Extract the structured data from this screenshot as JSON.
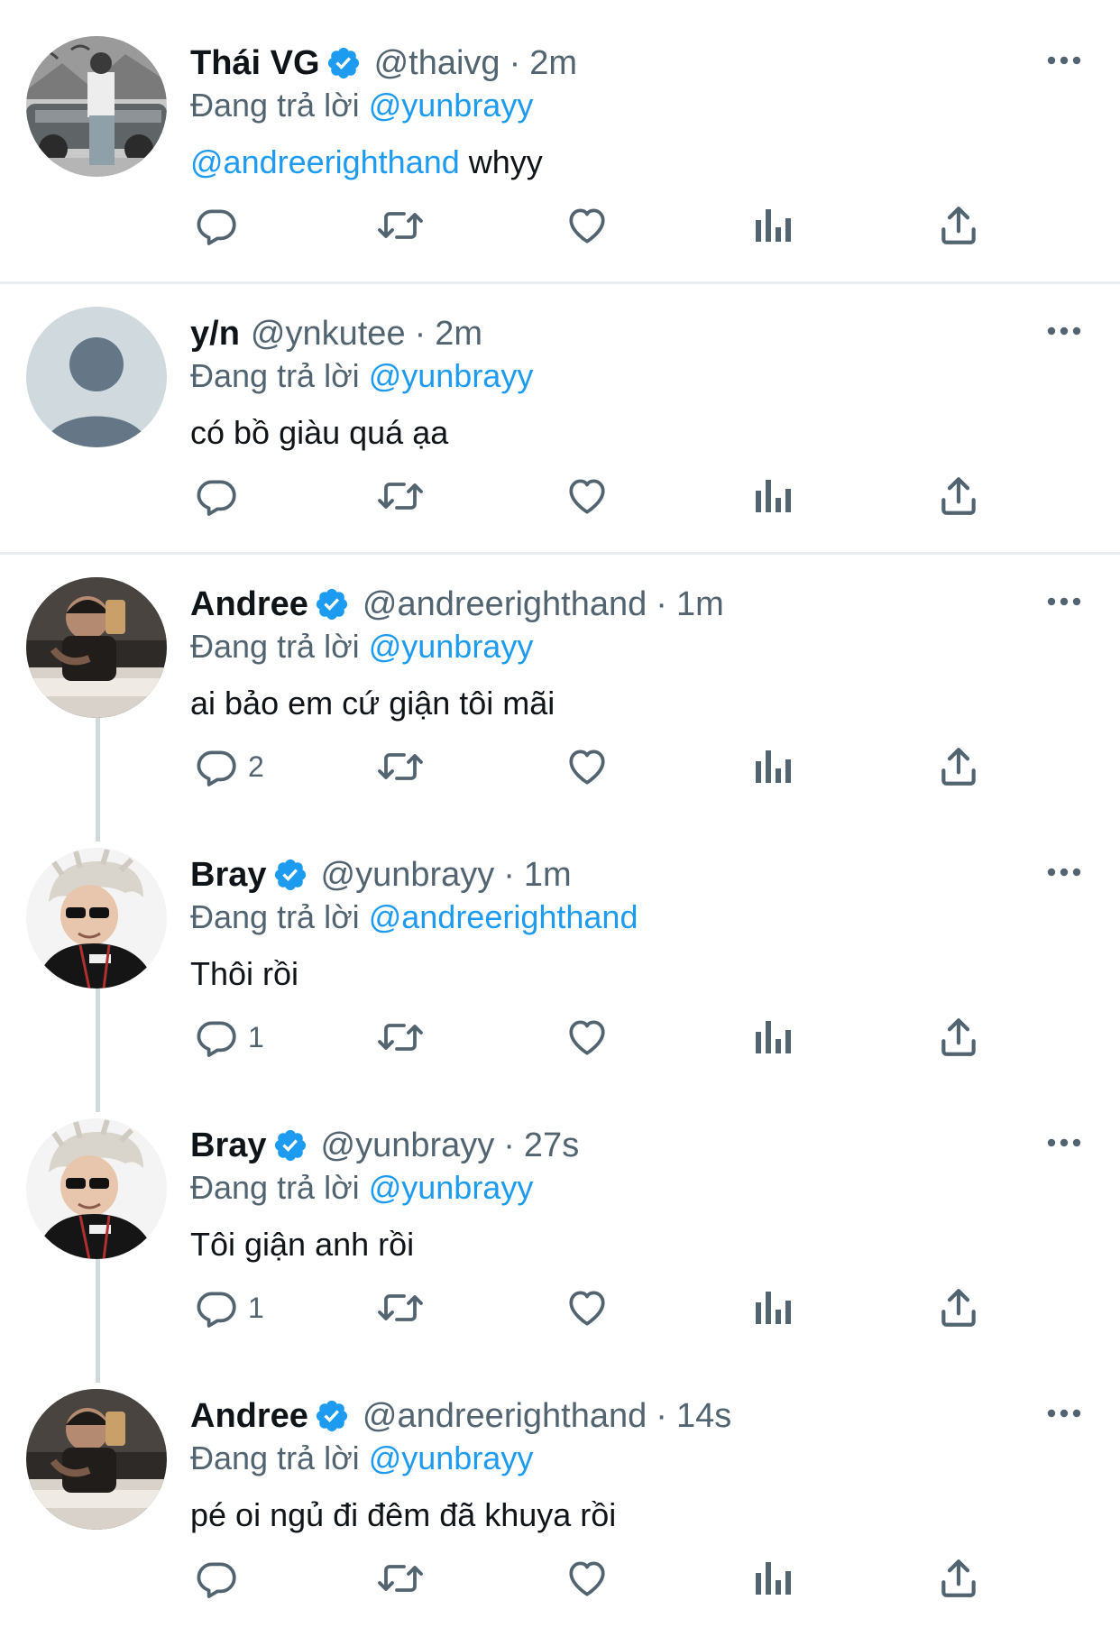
{
  "colors": {
    "accent": "#1d9bf0",
    "text_primary": "#0f1419",
    "text_secondary": "#536471",
    "icon": "#536471",
    "separator": "#e6ecf0",
    "thread_line": "#d1d9dd"
  },
  "icons": {
    "reply": "speech-bubble-icon",
    "retweet": "retweet-arrows-icon",
    "like": "heart-outline-icon",
    "views": "bar-chart-icon",
    "share": "upload-arrow-icon",
    "more": "ellipsis-icon",
    "verified": "verified-badge-icon"
  },
  "tweets": [
    {
      "name": "Thái VG",
      "verified": true,
      "handle": "@thaivg",
      "time": "2m",
      "reply_prefix": "Đang trả lời",
      "reply_to": "@yunbrayy",
      "body_mention": "@andreerighthand",
      "body_text": "whyy",
      "reply_count": "",
      "avatar": "vintage-car-photo"
    },
    {
      "name": "y/n",
      "verified": false,
      "handle": "@ynkutee",
      "time": "2m",
      "reply_prefix": "Đang trả lời",
      "reply_to": "@yunbrayy",
      "body_mention": "",
      "body_text": "có bồ giàu quá ạa",
      "reply_count": "",
      "avatar": "default-profile"
    },
    {
      "name": "Andree",
      "verified": true,
      "handle": "@andreerighthand",
      "time": "1m",
      "reply_prefix": "Đang trả lời",
      "reply_to": "@yunbrayy",
      "body_mention": "",
      "body_text": "ai bảo em cứ giận tôi mãi",
      "reply_count": "2",
      "avatar": "mirror-selfie"
    },
    {
      "name": "Bray",
      "verified": true,
      "handle": "@yunbrayy",
      "time": "1m",
      "reply_prefix": "Đang trả lời",
      "reply_to": "@andreerighthand",
      "body_mention": "",
      "body_text": "Thôi rồi",
      "reply_count": "1",
      "avatar": "blond-hair-portrait"
    },
    {
      "name": "Bray",
      "verified": true,
      "handle": "@yunbrayy",
      "time": "27s",
      "reply_prefix": "Đang trả lời",
      "reply_to": "@yunbrayy",
      "body_mention": "",
      "body_text": "Tôi giận anh rồi",
      "reply_count": "1",
      "avatar": "blond-hair-portrait"
    },
    {
      "name": "Andree",
      "verified": true,
      "handle": "@andreerighthand",
      "time": "14s",
      "reply_prefix": "Đang trả lời",
      "reply_to": "@yunbrayy",
      "body_mention": "",
      "body_text": "pé oi ngủ đi đêm đã khuya rồi",
      "reply_count": "",
      "avatar": "mirror-selfie"
    }
  ]
}
